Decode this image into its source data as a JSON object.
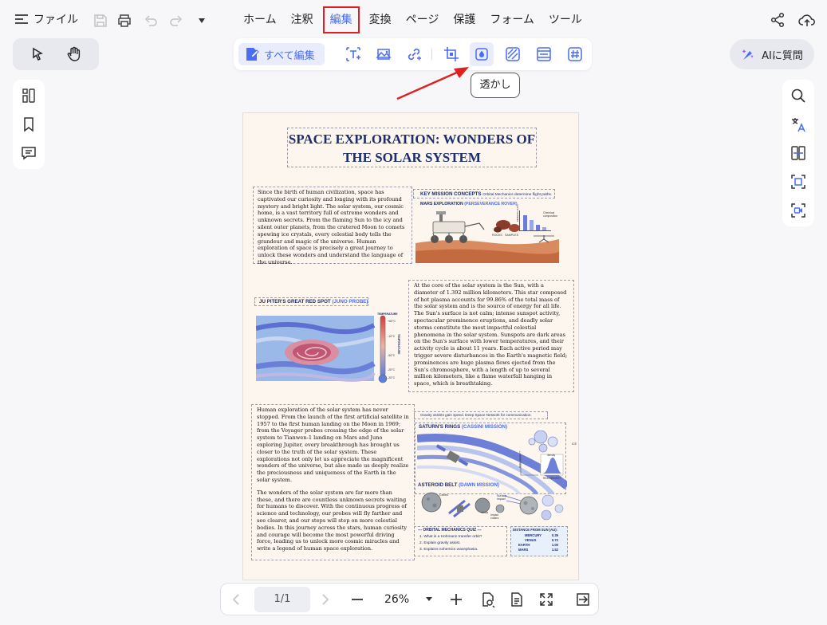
{
  "app": {
    "file_label": "ファイル"
  },
  "menu": [
    "ホーム",
    "注釈",
    "編集",
    "変換",
    "ページ",
    "保護",
    "フォーム",
    "ツール"
  ],
  "editbar": {
    "edit_all": "すべて編集",
    "tooltip": "透かし"
  },
  "ai": {
    "label": "AIに質問"
  },
  "doc": {
    "title": "SPACE EXPLORATION: WONDERS OF THE SOLAR SYSTEM",
    "p1": "Since the birth of human civilization, space has captivated our curiosity and longing with its profound mystery and bright light. The solar system, our cosmic home, is a vast territory full of extreme wonders and unknown secrets. From the flaming Sun to the icy and silent outer planets, from the cratered Moon to comets spewing ice crystals, every celestial body tells the grandeur and magic of the universe. Human exploration of space is precisely a great journey to unlock these wonders and understand the language of the universe.",
    "key_title": "KEY MISSION CONCEPTS",
    "key_sub": "Orbital Mechanics determine flight paths.",
    "mars_title": "MARS EXPLORATION",
    "mars_mission": "(PERSEVERANCE ROVER)",
    "mars_labels": [
      "ROCKS",
      "SAMPLES",
      "Chemical composition",
      "MINERAL DATA"
    ],
    "jupiter_title": "JU PITER'S GREAT RED SPOT",
    "jupiter_mission": "(JUNO PROBE)",
    "temp_labels": [
      "TEMPERATURE",
      "+60°C",
      "-10°C",
      "-50°C",
      "-20°C",
      "-20°C",
      "TEMPERATURE"
    ],
    "p2": "At the core of the solar system is the Sun, with a diameter of 1.392 million kilometers. This star composed of hot plasma accounts for 99.86% of the total mass of the solar system and is the source of energy for all life. The Sun's surface is not calm; intense sunspot activity, spectacular prominence eruptions, and deadly solar storms constitute the most impactful celestial phenomena in the solar system. Sunspots are dark areas on the Sun's surface with lower temperatures, and their activity cycle is about 11 years. Each active period may trigger severe disturbances in the Earth's magnetic field; prominences are huge plasma flows ejected from the Sun's chromosphere, with a length of up to several million kilometers, like a flame waterfall hanging in space, which is breathtaking.",
    "p3": "Human exploration of the solar system has never stopped. From the launch of the first artificial satellite in 1957 to the first human landing on the Moon in 1969; from the Voyager probes crossing the edge of the solar system to Tianwen-1 landing on Mars and Juno exploring Jupiter, every breakthrough has brought us closer to the truth of the solar system. These explorations not only let us appreciate the magnificent wonders of the universe, but also made us deeply realize the preciousness and uniqueness of the Earth in the solar system.",
    "p4": "The wonders of the solar system are far more than these, and there are countless unknown secrets waiting for humans to discover. With the continuous progress of science and technology, our probes will fly farther and see clearer, and our steps will step on more celestial bodies. In this journey across the stars, human curiosity and courage will become the most powerful driving force, leading us to unlock more cosmic miracles and write a legend of human space exploration.",
    "gravity": "Gravity assists gain speed. Deep Space Network for communication.",
    "saturn_title": "SATURN'S RINGS",
    "saturn_mission": "(CASSINI MISSION)",
    "saturn_labels": [
      "ICE",
      "RING DENSITY",
      "density",
      "RING DENSITY"
    ],
    "asteroid_title": "ASTEROID BELT",
    "asteroid_mission": "(DAWN MISSION)",
    "asteroid_labels": [
      "Ceres",
      "Vesta",
      "Surface impact",
      "Impact craters"
    ],
    "quiz_title": "ORBITAL MECHANICS QUIZ",
    "quiz_items": [
      "1.  What is a Hohmann transfer orbit?",
      "2.  Explain gravity assist.",
      "3.  Explains nohemics wavephasia."
    ],
    "dist_title": "DISTANCE FROM SUN (AU):",
    "dist_rows": [
      [
        "MERCURY",
        "0.39"
      ],
      [
        "VENUS",
        "0.72"
      ],
      [
        "EARTH",
        "1.00"
      ],
      [
        "MARS",
        "1.52"
      ]
    ]
  },
  "bottom": {
    "page": "1/1",
    "zoom": "26%"
  },
  "colors": {
    "accent": "#4a6cf7",
    "highlight": "#e02020"
  }
}
